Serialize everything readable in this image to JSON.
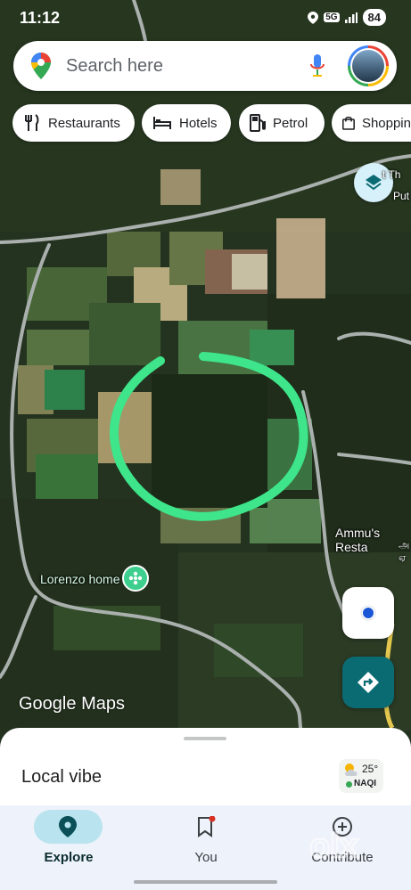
{
  "status_bar": {
    "time": "11:12",
    "network": "5G",
    "battery": "84"
  },
  "search": {
    "placeholder": "Search here"
  },
  "chips": [
    {
      "label": "Restaurants",
      "icon": "fork-knife-icon"
    },
    {
      "label": "Hotels",
      "icon": "bed-icon"
    },
    {
      "label": "Petrol",
      "icon": "fuel-pump-icon"
    },
    {
      "label": "Shoppin",
      "icon": "shopping-bag-icon"
    }
  ],
  "map": {
    "labels": {
      "top_right_a": "t Th",
      "top_right_b": "Put",
      "restaurant": "Ammu's Resta",
      "restaurant_local_a": "அ",
      "restaurant_local_b": "ஏ",
      "home": "Lorenzo home"
    },
    "annotation_color": "#3ee58a",
    "logo_google": "Google",
    "logo_maps": "Maps"
  },
  "sheet": {
    "title": "Local vibe",
    "weather_temp": "25°",
    "weather_aqi": "NAQI"
  },
  "nav": [
    {
      "label": "Explore",
      "icon": "location-pin-icon",
      "active": true
    },
    {
      "label": "You",
      "icon": "bookmark-icon",
      "active": false
    },
    {
      "label": "Contribute",
      "icon": "add-circle-icon",
      "active": false
    }
  ],
  "watermark": "olx",
  "colors": {
    "accent": "#0b6b73",
    "nav_active": "#b9e4ef",
    "location_dot": "#1a57d6"
  }
}
